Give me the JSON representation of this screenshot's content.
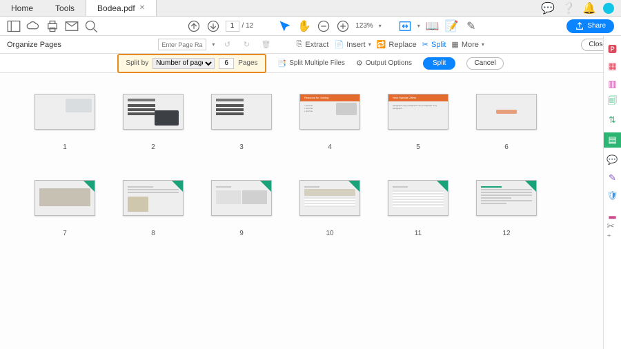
{
  "tabs": {
    "home": "Home",
    "tools": "Tools",
    "file": "Bodea.pdf"
  },
  "page": {
    "current": "1",
    "total": "/ 12",
    "zoom": "123%"
  },
  "share_label": "Share",
  "org": {
    "title": "Organize Pages",
    "page_range_placeholder": "Enter Page Range",
    "tools": {
      "extract": "Extract",
      "insert": "Insert",
      "replace": "Replace",
      "split": "Split",
      "more": "More"
    },
    "close": "Close"
  },
  "splitbar": {
    "splitby": "Split by",
    "method": "Number of pages",
    "value": "6",
    "pages": "Pages",
    "multi": "Split Multiple Files",
    "output": "Output Options",
    "split": "Split",
    "cancel": "Cancel"
  },
  "thumbs": [
    {
      "n": "1"
    },
    {
      "n": "2"
    },
    {
      "n": "3"
    },
    {
      "n": "4"
    },
    {
      "n": "5"
    },
    {
      "n": "6"
    },
    {
      "n": "7"
    },
    {
      "n": "8"
    },
    {
      "n": "9"
    },
    {
      "n": "10"
    },
    {
      "n": "11"
    },
    {
      "n": "12"
    }
  ],
  "slide_titles": {
    "s2": "Customer Survey",
    "s4": "Reasons for Joining",
    "s5": "New Special Offers"
  }
}
